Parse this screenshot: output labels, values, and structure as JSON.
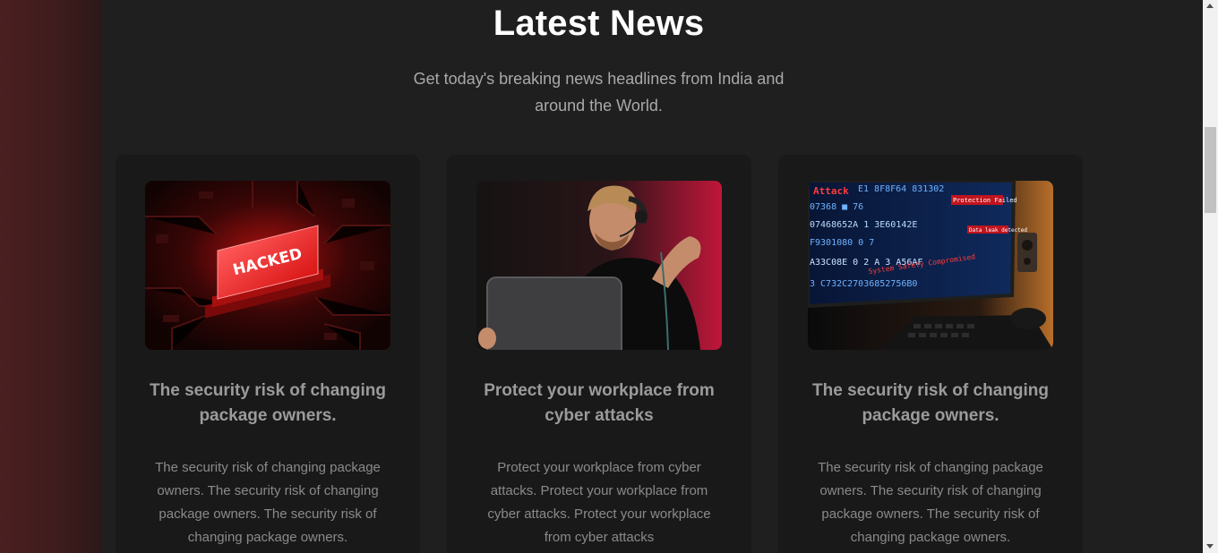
{
  "section": {
    "title": "Latest News",
    "subtitle": "Get today's breaking news headlines from India and around the World."
  },
  "cards": [
    {
      "image_icon": "hacked-chip-image",
      "image_text": "HACKED",
      "title": "The security risk of changing package owners.",
      "text": "The security risk of changing package owners. The security risk of changing package owners. The security risk of changing package owners."
    },
    {
      "image_icon": "man-with-headset-laptop-image",
      "title": "Protect your workplace from cyber attacks",
      "text": "Protect your workplace from cyber attacks. Protect your workplace from cyber attacks. Protect your workplace from cyber attacks"
    },
    {
      "image_icon": "monitor-code-attack-image",
      "image_text": {
        "attack": "Attack",
        "protection_failed": "Protection Failed",
        "data_leak": "Data leak detected",
        "safety_compromised": "System Safety Compromised",
        "code_lines": [
          "E1   8F8F64  831302",
          "07368  ■  76",
          "07468652A  1 3E60142E",
          "F9301080  0  7",
          "A33C08E  0 2 A 3  A56AF",
          "3 C732C27036852756B0"
        ]
      },
      "title": "The security risk of changing package owners.",
      "text": "The security risk of changing package owners. The security risk of changing package owners. The security risk of changing package owners."
    }
  ],
  "colors": {
    "background": "#1f1f1f",
    "card": "#191919",
    "title": "#ffffff",
    "subtitle": "#a9a9a9",
    "card_title": "#9b9b9b",
    "card_text": "#8a8a8a",
    "accent_red": "#ff2a2a"
  }
}
